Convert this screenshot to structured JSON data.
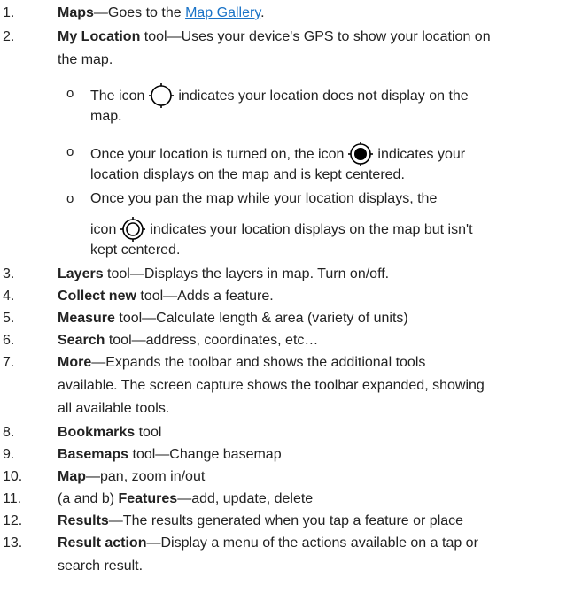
{
  "items": [
    {
      "num": "1.",
      "bold": "Maps",
      "text": "—Goes to the ",
      "link": "Map Gallery",
      "after": "."
    },
    {
      "num": "2.",
      "bold": "My Location",
      "line1": " tool—Uses your device's GPS to show your location on",
      "line2": "the map."
    },
    {
      "num": "3.",
      "bold": "Layers",
      "text": " tool—Displays the layers in map. Turn on/off."
    },
    {
      "num": "4.",
      "bold": "Collect new",
      "text": " tool—Adds a feature."
    },
    {
      "num": "5.",
      "bold": "Measure",
      "text": " tool—Calculate length & area (variety of units)"
    },
    {
      "num": "6.",
      "bold": "Search",
      "text": " tool—address, coordinates, etc…"
    },
    {
      "num": "7.",
      "bold": "More",
      "line1": "—Expands the toolbar and shows the additional tools",
      "line2": "available. The screen capture shows the toolbar expanded, showing",
      "line3": "all available tools."
    },
    {
      "num": "8.",
      "bold": "Bookmarks",
      "text": " tool"
    },
    {
      "num": "9.",
      "bold": "Basemaps",
      "text": " tool—Change basemap"
    },
    {
      "num": "10.",
      "bold": "Map",
      "text": "—pan, zoom in/out"
    },
    {
      "num": "11.",
      "prefix": "(a and b) ",
      "bold": "Features",
      "text": "—add, update, delete"
    },
    {
      "num": "12.",
      "bold": "Results",
      "text": "—The results generated when you tap a feature or place"
    },
    {
      "num": "13.",
      "bold": "Result action",
      "line1": "—Display a menu of the actions available on a tap or",
      "line2": "search result."
    }
  ],
  "location_states": [
    {
      "bullet": "o",
      "pre": "The icon",
      "post": "indicates your location does not display on the",
      "line2": "map.",
      "icon": "location-off-icon"
    },
    {
      "bullet": "o",
      "pre": "Once your location is turned on, the icon",
      "post": "indicates your",
      "line2": "location displays on the map and is kept centered.",
      "icon": "location-centered-icon"
    },
    {
      "bullet": "o",
      "line1": "Once you pan the map while your location displays, the",
      "pre": "icon",
      "post": "indicates your location displays on the map but isn't",
      "line3": "kept centered.",
      "icon": "location-not-centered-icon"
    }
  ]
}
